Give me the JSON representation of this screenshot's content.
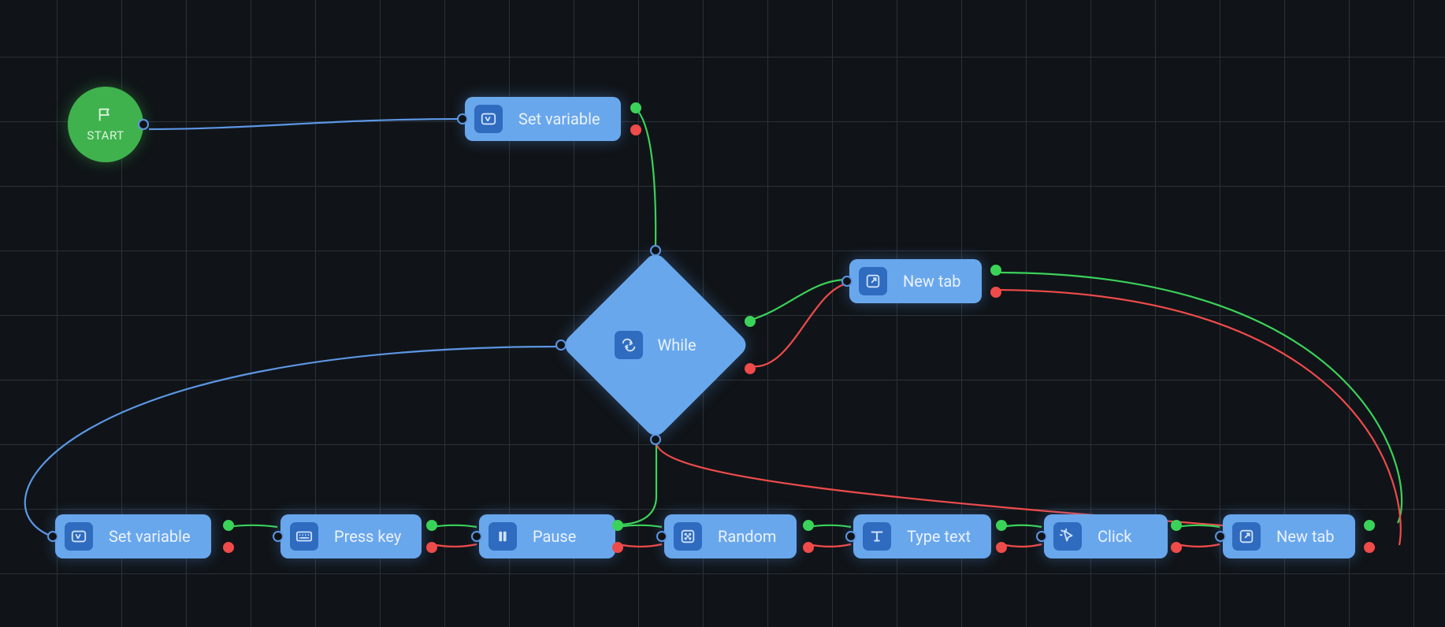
{
  "colors": {
    "node_bg": "#69a7ed",
    "node_icon_bg": "#2f6bbf",
    "start_bg": "#3fb24d",
    "canvas": "#101418",
    "grid": "#2b3138",
    "edge_blue": "#5c96e4",
    "edge_green": "#3bd25a",
    "edge_red": "#ef4b4b"
  },
  "start": {
    "label": "START",
    "icon": "flag-icon"
  },
  "nodes": {
    "set_variable_top": {
      "label": "Set variable",
      "icon": "variable-icon"
    },
    "while": {
      "label": "While",
      "icon": "loop-icon"
    },
    "new_tab_right": {
      "label": "New tab",
      "icon": "external-icon"
    },
    "row": [
      {
        "id": "set_variable",
        "label": "Set variable",
        "icon": "variable-icon"
      },
      {
        "id": "press_key",
        "label": "Press key",
        "icon": "keyboard-icon"
      },
      {
        "id": "pause",
        "label": "Pause",
        "icon": "pause-icon"
      },
      {
        "id": "random",
        "label": "Random",
        "icon": "dice-icon"
      },
      {
        "id": "type_text",
        "label": "Type text",
        "icon": "type-icon"
      },
      {
        "id": "click",
        "label": "Click",
        "icon": "cursor-click-icon"
      },
      {
        "id": "new_tab",
        "label": "New tab",
        "icon": "external-icon"
      }
    ]
  },
  "edges": [
    {
      "from": "start",
      "to": "set_variable_top",
      "kind": "blue"
    },
    {
      "from": "set_variable_top",
      "to": "while",
      "kind": "green"
    },
    {
      "from": "while",
      "to": "new_tab_right",
      "kind": "green"
    },
    {
      "from": "while",
      "to": "new_tab_right",
      "kind": "red"
    },
    {
      "from": "new_tab_right",
      "to": "row.new_tab",
      "kind": "green"
    },
    {
      "from": "new_tab_right",
      "to": "row.new_tab",
      "kind": "red"
    },
    {
      "from": "while.bottom",
      "to": "row.pause",
      "kind": "green"
    },
    {
      "from": "while.bottom",
      "to": "row.new_tab",
      "kind": "red"
    },
    {
      "from": "row.set_variable",
      "to": "while.left",
      "kind": "blue"
    },
    {
      "from": "row.set_variable",
      "to": "row.press_key",
      "kind": "green"
    },
    {
      "from": "row.press_key",
      "to": "row.pause",
      "kind": "green"
    },
    {
      "from": "row.press_key",
      "to": "row.pause",
      "kind": "red"
    },
    {
      "from": "row.pause",
      "to": "row.random",
      "kind": "green"
    },
    {
      "from": "row.pause",
      "to": "row.random",
      "kind": "red"
    },
    {
      "from": "row.random",
      "to": "row.type_text",
      "kind": "green"
    },
    {
      "from": "row.random",
      "to": "row.type_text",
      "kind": "red"
    },
    {
      "from": "row.type_text",
      "to": "row.click",
      "kind": "green"
    },
    {
      "from": "row.type_text",
      "to": "row.click",
      "kind": "red"
    },
    {
      "from": "row.click",
      "to": "row.new_tab",
      "kind": "green"
    },
    {
      "from": "row.click",
      "to": "row.new_tab",
      "kind": "red"
    }
  ]
}
